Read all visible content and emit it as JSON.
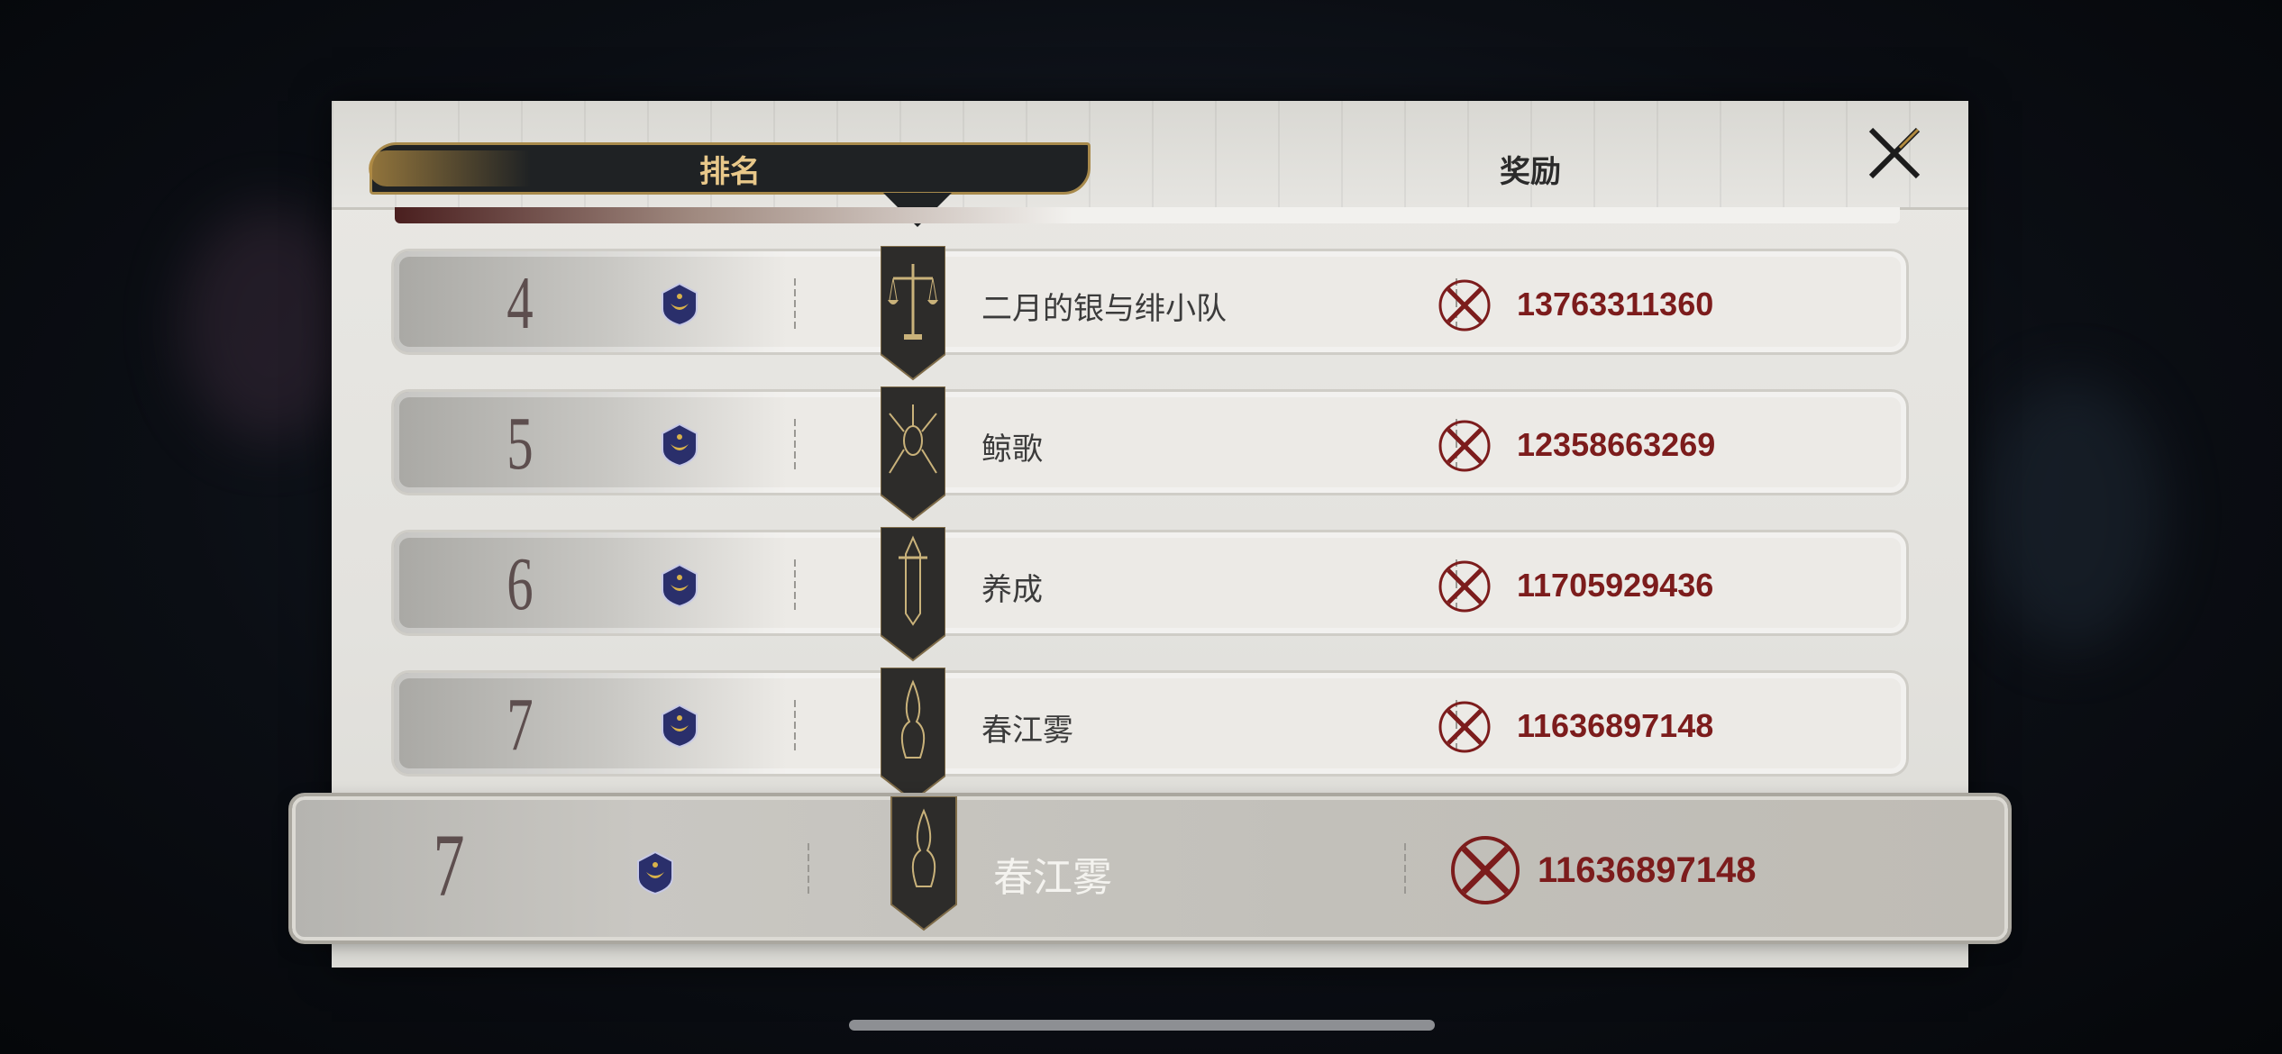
{
  "tabs": {
    "rank_label": "排名",
    "reward_label": "奖励"
  },
  "rows": [
    {
      "rank": "4",
      "name": "二月的银与绯小队",
      "score": "13763311360",
      "emblem": "scales-icon"
    },
    {
      "rank": "5",
      "name": "鲸歌",
      "score": "12358663269",
      "emblem": "spider-icon"
    },
    {
      "rank": "6",
      "name": "养成",
      "score": "11705929436",
      "emblem": "sword-icon"
    },
    {
      "rank": "7",
      "name": "春江雾",
      "score": "11636897148",
      "emblem": "flame-icon"
    }
  ],
  "self_row": {
    "rank": "7",
    "name": "春江雾",
    "score": "11636897148",
    "emblem": "flame-icon"
  },
  "colors": {
    "score": "#7c1c1c",
    "gold": "#e8c88a",
    "navy": "#2a2f6b"
  }
}
